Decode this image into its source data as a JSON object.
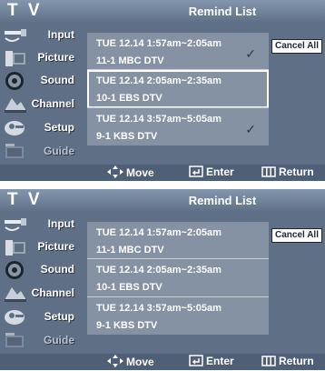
{
  "screens": [
    {
      "tv_label": "T V",
      "title": "Remind List",
      "sidebar": [
        {
          "label": "Input",
          "icon": "input-icon"
        },
        {
          "label": "Picture",
          "icon": "picture-icon"
        },
        {
          "label": "Sound",
          "icon": "sound-icon"
        },
        {
          "label": "Channel",
          "icon": "channel-icon"
        },
        {
          "label": "Setup",
          "icon": "setup-icon"
        },
        {
          "label": "Guide",
          "icon": "guide-icon"
        }
      ],
      "reminders": [
        {
          "time": "TUE  12.14   1:57am~2:05am",
          "channel": "11-1  MBC  DTV",
          "checked": true,
          "selected": false
        },
        {
          "time": "TUE  12.14   2:05am~2:35am",
          "channel": "10-1  EBS  DTV",
          "checked": false,
          "selected": true
        },
        {
          "time": "TUE  12.14   3:57am~5:05am",
          "channel": "9-1  KBS  DTV",
          "checked": true,
          "selected": false
        }
      ],
      "cancel_all": "Cancel All",
      "hints": {
        "move": "Move",
        "enter": "Enter",
        "return": "Return"
      },
      "check_mark": "✓"
    },
    {
      "tv_label": "T V",
      "title": "Remind List",
      "sidebar": [
        {
          "label": "Input",
          "icon": "input-icon"
        },
        {
          "label": "Picture",
          "icon": "picture-icon"
        },
        {
          "label": "Sound",
          "icon": "sound-icon"
        },
        {
          "label": "Channel",
          "icon": "channel-icon"
        },
        {
          "label": "Setup",
          "icon": "setup-icon"
        },
        {
          "label": "Guide",
          "icon": "guide-icon"
        }
      ],
      "reminders": [
        {
          "time": "TUE  12.14   1:57am~2:05am",
          "channel": "11-1  MBC  DTV",
          "checked": false,
          "selected": false
        },
        {
          "time": "TUE  12.14   2:05am~2:35am",
          "channel": "10-1  EBS  DTV",
          "checked": false,
          "selected": false
        },
        {
          "time": "TUE  12.14   3:57am~5:05am",
          "channel": "9-1  KBS  DTV",
          "checked": false,
          "selected": false
        }
      ],
      "cancel_all": "Cancel All",
      "hints": {
        "move": "Move",
        "enter": "Enter",
        "return": "Return"
      },
      "check_mark": "✓"
    }
  ]
}
